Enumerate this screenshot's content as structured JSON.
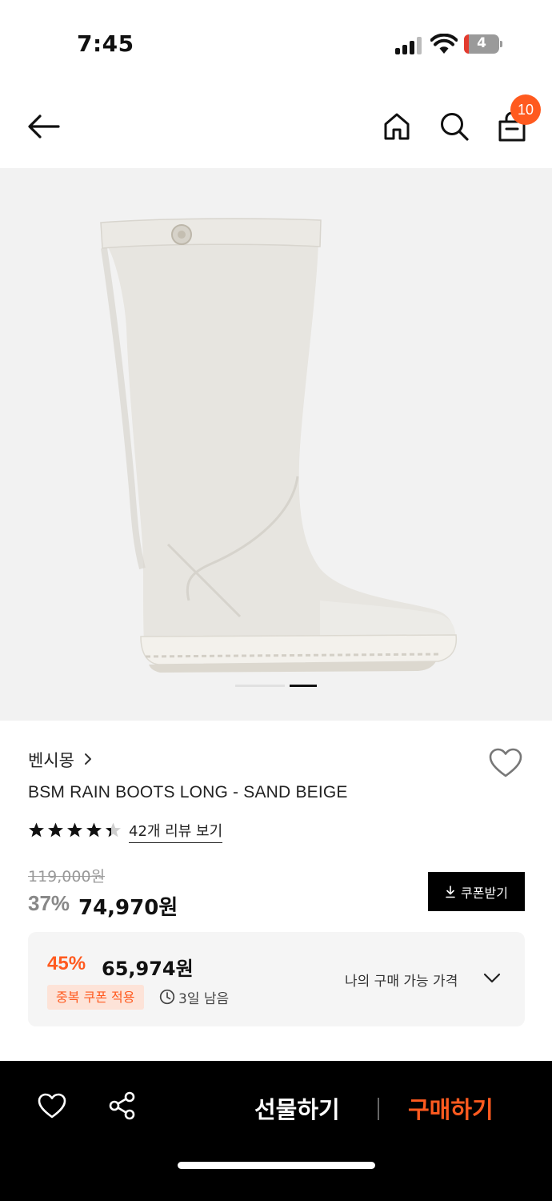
{
  "status_bar": {
    "time": "7:45",
    "battery": "4"
  },
  "nav": {
    "cart_count": "10"
  },
  "gallery": {
    "total_images": 2,
    "active_index": 2
  },
  "product": {
    "brand": "벤시몽",
    "name": "BSM RAIN BOOTS LONG - SAND BEIGE",
    "rating": 4.5,
    "review_link": "42개 리뷰 보기",
    "original_price": "119,000원",
    "discount_rate": "37%",
    "sale_price": "74,970원",
    "coupon_button": "쿠폰받기"
  },
  "my_price": {
    "discount_rate": "45%",
    "price": "65,974원",
    "coupon_tag": "중복 쿠폰 적용",
    "remaining": "3일 남음",
    "label": "나의 구매 가능 가격"
  },
  "bottom_bar": {
    "gift": "선물하기",
    "buy": "구매하기"
  },
  "colors": {
    "accent": "#ff5a1f",
    "hero_bg": "#f2f2f2",
    "boot": "#e7e5e0"
  }
}
